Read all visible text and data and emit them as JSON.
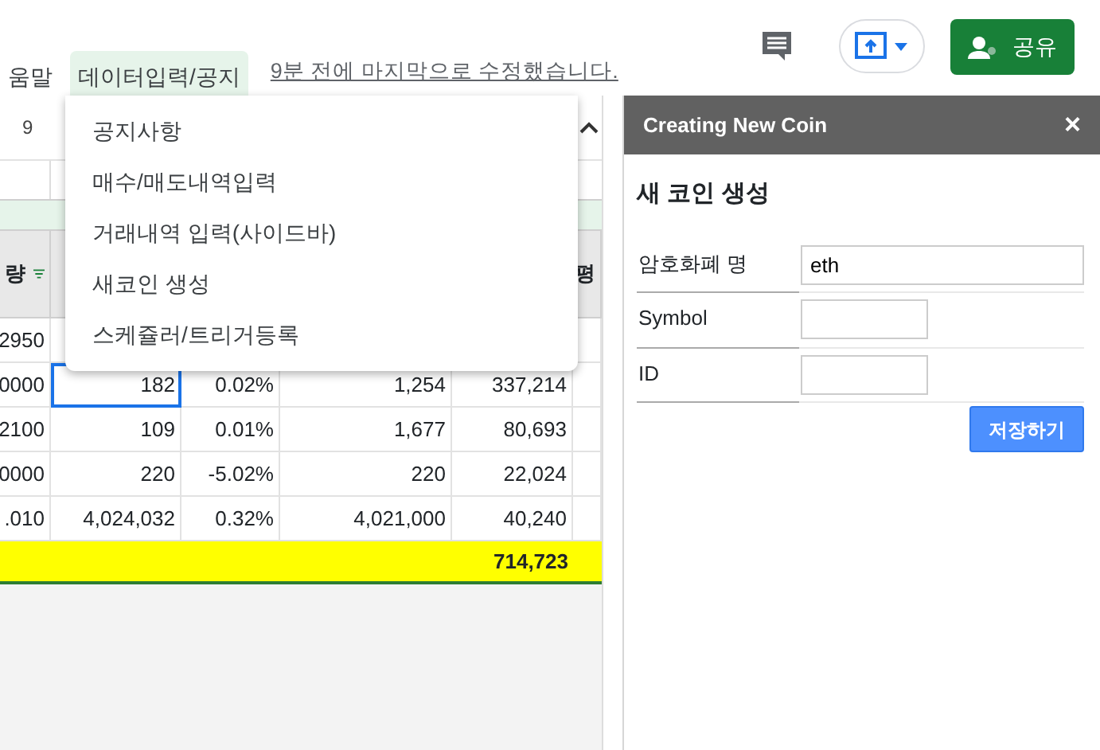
{
  "menu_bar": {
    "items": [
      {
        "label": "움말",
        "selected": false
      },
      {
        "label": "데이터입력/공지",
        "selected": true
      }
    ],
    "last_edit": "9분 전에 마지막으로 수정했습니다."
  },
  "top_actions": {
    "share_button": "공유"
  },
  "toolbar": {
    "font_size": "9"
  },
  "dropdown": {
    "items": [
      "공지사항",
      "매수/매도내역입력",
      "거래내역 입력(사이드바)",
      "새코인 생성",
      "스케쥴러/트리거등록"
    ]
  },
  "sheet": {
    "header_first": {
      "text": "량",
      "filtered": true
    },
    "header_last": "평",
    "rows": [
      [
        {
          "text": "2950",
          "selected": false
        }
      ],
      [
        {
          "text": "0000",
          "selected": false
        },
        {
          "text": "182",
          "selected": true
        },
        {
          "text": "0.02%",
          "selected": false
        },
        {
          "text": "1,254",
          "selected": false
        },
        {
          "text": "337,214",
          "selected": false
        }
      ],
      [
        {
          "text": "2100",
          "selected": false
        },
        {
          "text": "109",
          "selected": false
        },
        {
          "text": "0.01%",
          "selected": false
        },
        {
          "text": "1,677",
          "selected": false
        },
        {
          "text": "80,693",
          "selected": false
        }
      ],
      [
        {
          "text": "0000",
          "selected": false
        },
        {
          "text": "220",
          "selected": false
        },
        {
          "text": "-5.02%",
          "selected": false
        },
        {
          "text": "220",
          "selected": false
        },
        {
          "text": "22,024",
          "selected": false
        }
      ],
      [
        {
          "text": ".010",
          "selected": false
        },
        {
          "text": "4,024,032",
          "selected": false
        },
        {
          "text": "0.32%",
          "selected": false
        },
        {
          "text": "4,021,000",
          "selected": false
        },
        {
          "text": "40,240",
          "selected": false
        }
      ]
    ],
    "total": "714,723"
  },
  "sidebar": {
    "title": "Creating New Coin",
    "close": "×",
    "heading": "새 코인 생성",
    "fields": [
      {
        "label": "암호화폐 명",
        "value": "eth",
        "kind": "wide"
      },
      {
        "label": "Symbol",
        "kind": "short"
      },
      {
        "label": "ID",
        "kind": "short"
      }
    ],
    "save_button": "저장하기"
  }
}
